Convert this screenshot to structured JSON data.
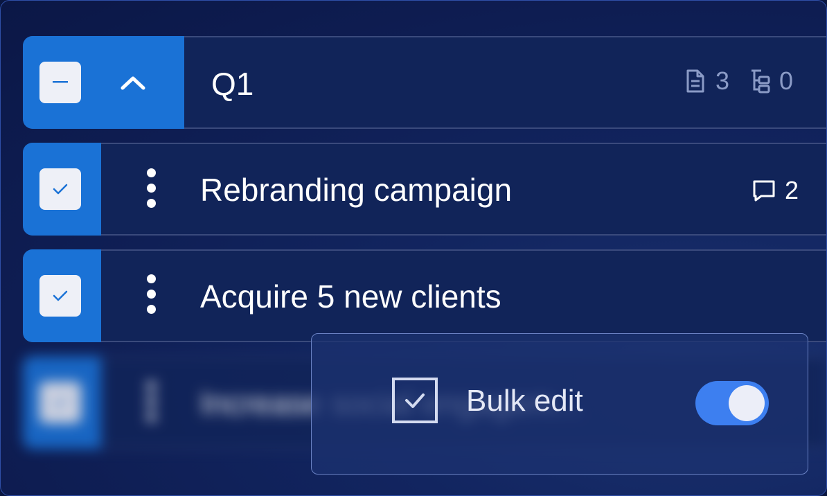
{
  "group": {
    "title": "Q1",
    "doc_count": "3",
    "subtask_count": "0"
  },
  "items": [
    {
      "label": "Rebranding campaign",
      "checked": true,
      "comment_count": "2"
    },
    {
      "label": "Acquire 5 new clients",
      "checked": true
    },
    {
      "label": "Increase social engagem...",
      "checked": true,
      "blurred": true
    }
  ],
  "bulk_edit": {
    "label": "Bulk edit",
    "enabled": true
  },
  "colors": {
    "accent": "#1a72d6",
    "toggle_on": "#3d7ff0",
    "background": "#0e1d52"
  }
}
